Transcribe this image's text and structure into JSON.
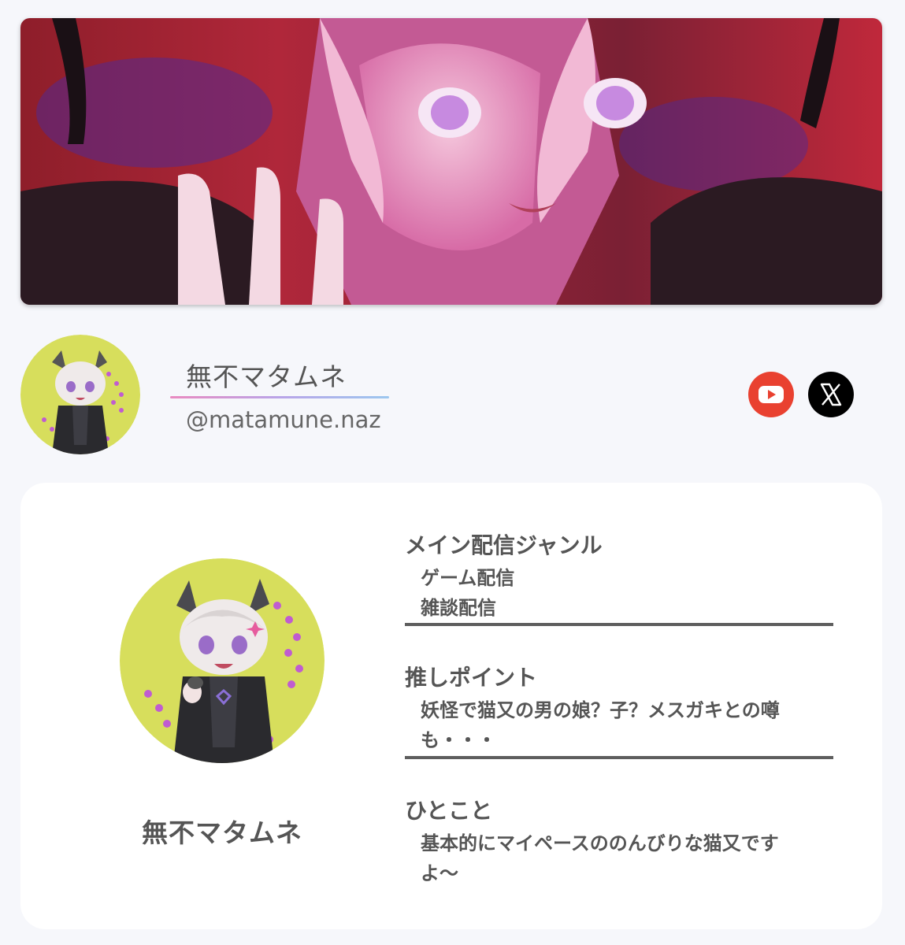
{
  "profile": {
    "display_name": "無不マタムネ",
    "handle": "@matamune.naz"
  },
  "social": {
    "youtube_icon": "youtube-icon",
    "x_icon": "x-logo-icon",
    "youtube_color": "#e94130",
    "x_color": "#000000"
  },
  "card": {
    "name": "無不マタムネ",
    "sections": [
      {
        "title": "メイン配信ジャンル",
        "lines": [
          "ゲーム配信",
          "雑談配信"
        ]
      },
      {
        "title": "推しポイント",
        "lines": [
          "妖怪で猫又の男の娘？子？メスガキとの噂",
          "も・・・"
        ]
      },
      {
        "title": "ひとこと",
        "lines": [
          "基本的にマイペースののんびりな猫又です",
          "よ〜"
        ]
      }
    ]
  },
  "colors": {
    "avatar_bg": "#d7de5c",
    "accent_pink": "#e98ac0",
    "divider": "#5e5e5e"
  }
}
